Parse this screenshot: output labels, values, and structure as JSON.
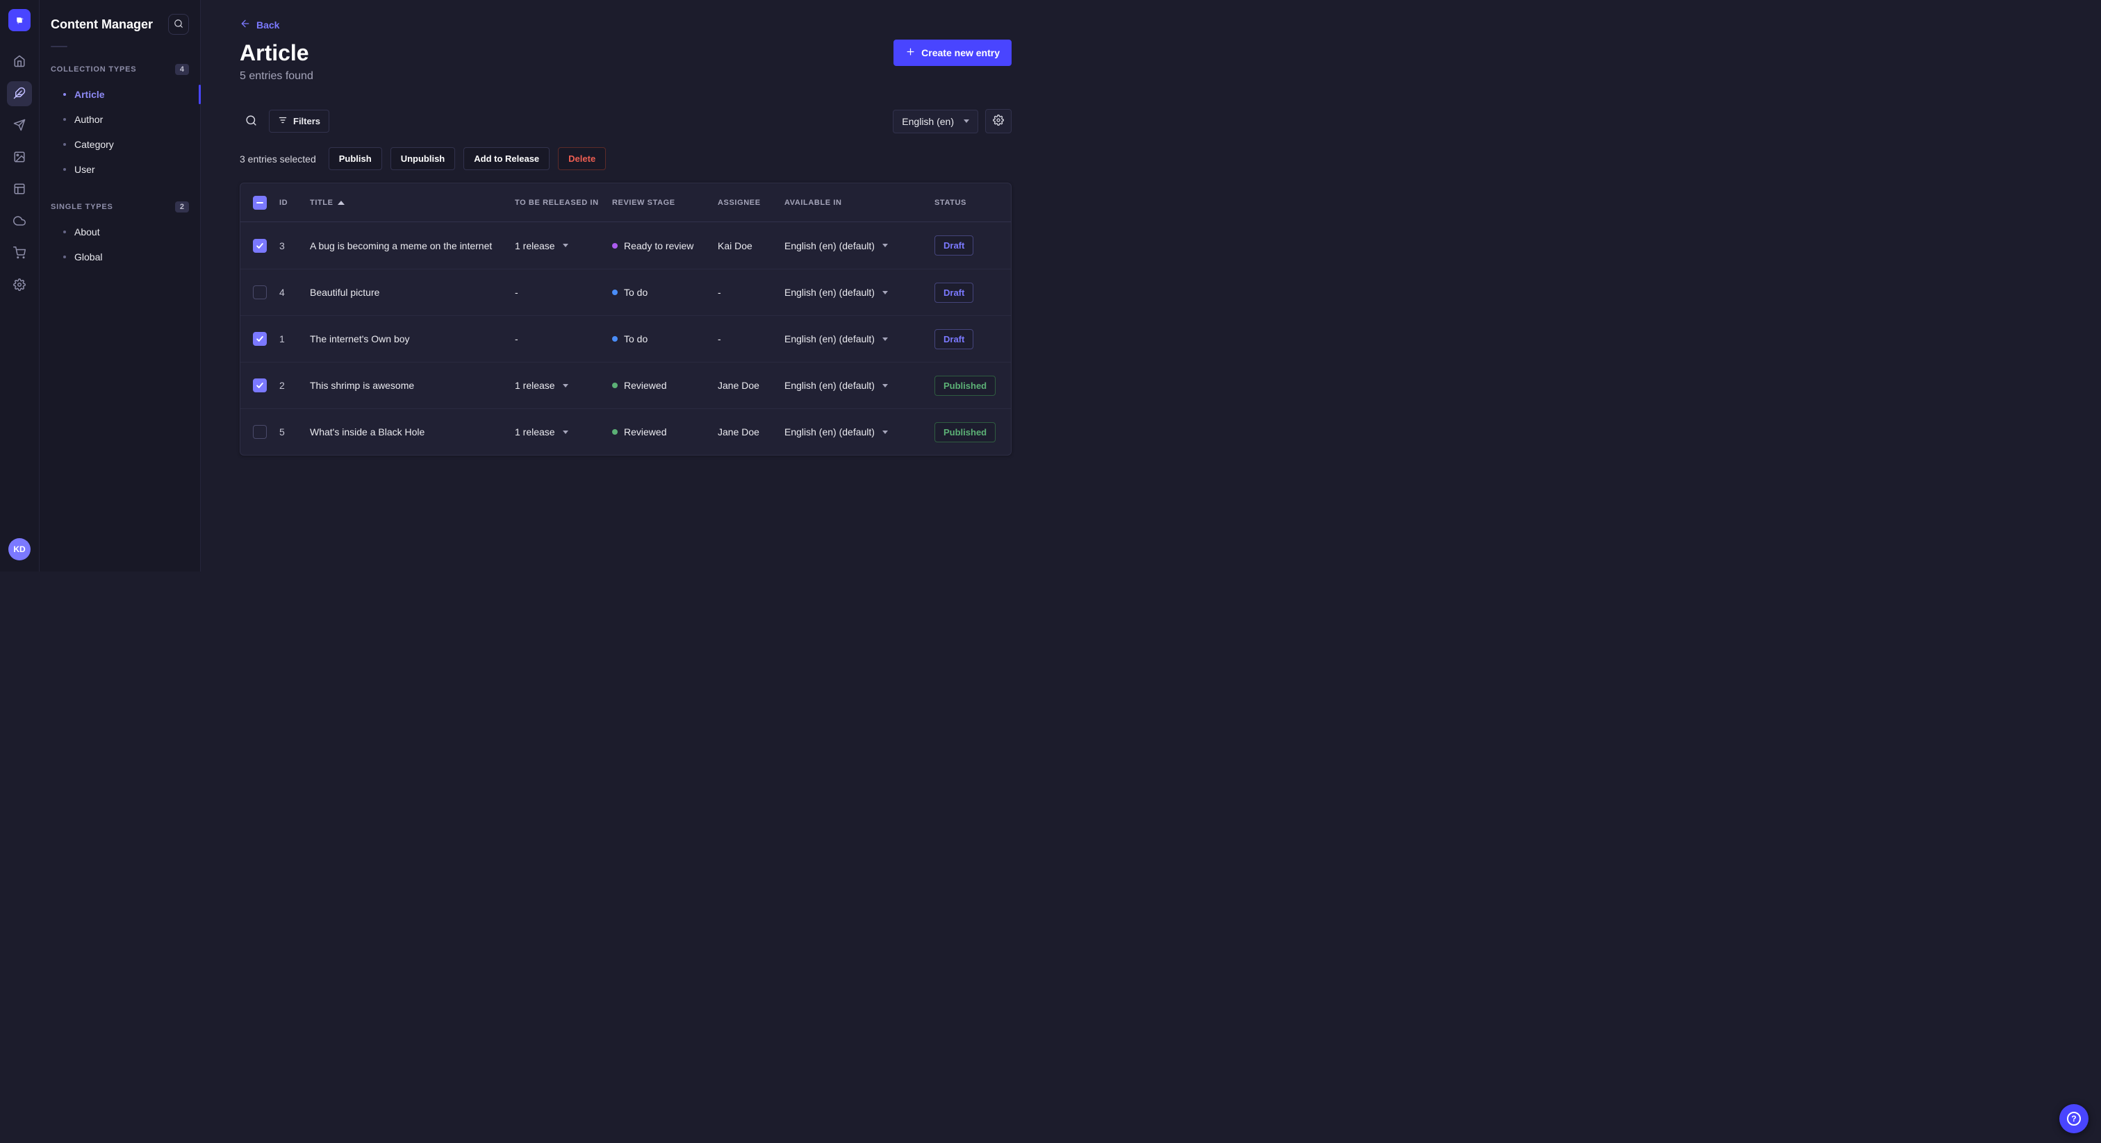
{
  "colors": {
    "primary": "#4945ff",
    "primary_light": "#7b79ff",
    "draft": "#7b79ff",
    "published": "#5cb176",
    "danger": "#ee5e52",
    "stage_todo": "#4a8df8",
    "stage_ready_to_review": "#ac5cf0",
    "stage_reviewed": "#5cb176"
  },
  "icons": [
    "strapi-logo",
    "home",
    "content-manager",
    "releases",
    "media-library",
    "content-type-builder",
    "cloud",
    "marketplace",
    "settings",
    "search",
    "filter",
    "plus",
    "back-arrow",
    "caret-down",
    "sort-ascending",
    "check",
    "minus",
    "question"
  ],
  "nav_rail": {
    "items": [
      {
        "name": "home",
        "active": false
      },
      {
        "name": "content-manager",
        "active": true
      },
      {
        "name": "releases",
        "active": false
      },
      {
        "name": "media-library",
        "active": false
      },
      {
        "name": "content-type-builder",
        "active": false
      },
      {
        "name": "cloud",
        "active": false
      },
      {
        "name": "marketplace",
        "active": false
      },
      {
        "name": "settings",
        "active": false
      }
    ],
    "avatar": "KD"
  },
  "sidebar": {
    "title": "Content Manager",
    "sections": [
      {
        "label": "COLLECTION TYPES",
        "count": "4",
        "items": [
          {
            "label": "Article",
            "active": true
          },
          {
            "label": "Author",
            "active": false
          },
          {
            "label": "Category",
            "active": false
          },
          {
            "label": "User",
            "active": false
          }
        ]
      },
      {
        "label": "SINGLE TYPES",
        "count": "2",
        "items": [
          {
            "label": "About",
            "active": false
          },
          {
            "label": "Global",
            "active": false
          }
        ]
      }
    ]
  },
  "header": {
    "back": "Back",
    "title": "Article",
    "subtitle": "5 entries found",
    "create_button": "Create new entry"
  },
  "toolbar": {
    "filters": "Filters",
    "locale": "English (en)"
  },
  "selection": {
    "label": "3 entries selected",
    "publish": "Publish",
    "unpublish": "Unpublish",
    "add_to_release": "Add to Release",
    "delete": "Delete"
  },
  "table": {
    "columns": {
      "id": "ID",
      "title": "TITLE",
      "release": "TO BE RELEASED IN",
      "review": "REVIEW STAGE",
      "assignee": "ASSIGNEE",
      "available": "AVAILABLE IN",
      "status": "STATUS"
    },
    "rows": [
      {
        "checked": true,
        "id": "3",
        "title": "A bug is becoming a meme on the internet",
        "release": "1 release",
        "release_dropdown": true,
        "review": "Ready to review",
        "review_color": "#ac5cf0",
        "assignee": "Kai Doe",
        "available": "English (en) (default)",
        "status": "Draft"
      },
      {
        "checked": false,
        "id": "4",
        "title": "Beautiful picture",
        "release": "-",
        "release_dropdown": false,
        "review": "To do",
        "review_color": "#4a8df8",
        "assignee": "-",
        "available": "English (en) (default)",
        "status": "Draft"
      },
      {
        "checked": true,
        "id": "1",
        "title": "The internet's Own boy",
        "release": "-",
        "release_dropdown": false,
        "review": "To do",
        "review_color": "#4a8df8",
        "assignee": "-",
        "available": "English (en) (default)",
        "status": "Draft"
      },
      {
        "checked": true,
        "id": "2",
        "title": "This shrimp is awesome",
        "release": "1 release",
        "release_dropdown": true,
        "review": "Reviewed",
        "review_color": "#5cb176",
        "assignee": "Jane Doe",
        "available": "English (en) (default)",
        "status": "Published"
      },
      {
        "checked": false,
        "id": "5",
        "title": "What's inside a Black Hole",
        "release": "1 release",
        "release_dropdown": true,
        "review": "Reviewed",
        "review_color": "#5cb176",
        "assignee": "Jane Doe",
        "available": "English (en) (default)",
        "status": "Published"
      }
    ]
  },
  "help": {
    "label": "?"
  }
}
